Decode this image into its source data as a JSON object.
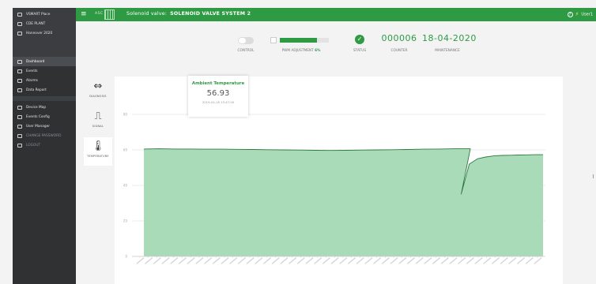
{
  "sidebar": {
    "items": [
      {
        "label": "VSMART Place",
        "icon": "grid-icon",
        "active": false
      },
      {
        "label": "CDE PLANT",
        "icon": "grid-icon",
        "active": false
      },
      {
        "label": "Hannover 2020",
        "icon": "grid-icon",
        "active": false
      },
      {
        "label": "Dashboard",
        "icon": "dashboard-icon",
        "active": true
      },
      {
        "label": "Events",
        "icon": "calendar-icon",
        "active": false
      },
      {
        "label": "Alarms",
        "icon": "alarm-icon",
        "active": false
      },
      {
        "label": "Data Report",
        "icon": "chart-icon",
        "active": false
      },
      {
        "label": "Device Map",
        "icon": "map-icon",
        "active": false
      },
      {
        "label": "Events Config",
        "icon": "calendar-icon",
        "active": false
      },
      {
        "label": "User Manager",
        "icon": "user-icon",
        "active": false
      },
      {
        "label": "CHANGE PASSWORD",
        "icon": "key-icon",
        "active": false
      },
      {
        "label": "LOGOUT",
        "icon": "logout-icon",
        "active": false
      }
    ]
  },
  "topbar": {
    "menu_glyph": "≡",
    "logo_text": "ASC",
    "title_prefix": "Solenoid valve:",
    "title_name": "SOLENOID VALVE SYSTEM 2",
    "help_glyph": "?",
    "bolt_glyph": "⚡",
    "user_text": "User1",
    "bg_color": "#2e9a43"
  },
  "status": {
    "control_label": "CONTROL",
    "pwm_label": "PWM ADJUSTMENT",
    "pwm_value": "6%",
    "pwm_fraction": 0.75,
    "status_label": "STATUS",
    "status_glyph": "✓",
    "counter_value": "000006",
    "counter_label": "COUNTER",
    "maintenance_value": "18-04-2020",
    "maintenance_label": "MAINTENANCE"
  },
  "left_tabs": [
    {
      "label": "DIAGNOSIS",
      "glyph": "⇔",
      "icon": "pressure-icon",
      "active": false
    },
    {
      "label": "SIGNAL",
      "glyph": "⎍",
      "icon": "signal-icon",
      "active": false
    },
    {
      "label": "TEMPERATURE",
      "glyph": "🌡",
      "icon": "thermometer-icon",
      "active": true
    }
  ],
  "tooltip": {
    "title": "Ambient Temperature",
    "value": "56.93",
    "time": "2019-04-18 13:47:00"
  },
  "chart_data": {
    "type": "area",
    "series": [
      {
        "values": [
          60.5,
          60.6,
          60.5,
          60.5,
          60.4,
          60.4,
          60.3,
          60.2,
          60.1,
          60.0,
          59.9,
          59.8,
          59.7,
          59.8,
          59.9,
          60.0,
          60.1,
          60.2,
          60.4,
          60.5,
          60.6,
          60.6,
          35,
          52,
          55,
          56,
          56.6,
          56.9,
          57.0,
          57.1,
          57.2,
          57.3,
          57.3
        ]
      }
    ],
    "ylim": [
      0,
      80
    ],
    "yticks": [
      0,
      20,
      40,
      60,
      80
    ],
    "x_tick_count": 48,
    "grid": true,
    "fill_color": "#a9dbb9",
    "line_color": "#2e7a3d"
  }
}
